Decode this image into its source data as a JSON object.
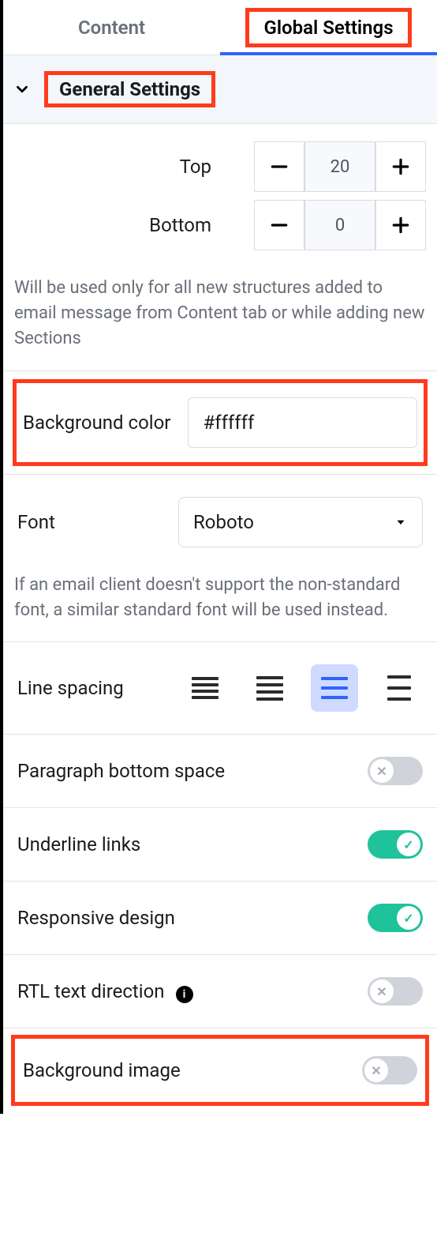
{
  "tabs": {
    "content": "Content",
    "global": "Global Settings",
    "active": "global"
  },
  "accordion": {
    "title": "General Settings"
  },
  "padding": {
    "top_label": "Top",
    "top_value": "20",
    "bottom_label": "Bottom",
    "bottom_value": "0",
    "helper": "Will be used only for all new structures added to email message from Content tab or while adding new Sections"
  },
  "bg_color": {
    "label": "Background color",
    "value": "#ffffff"
  },
  "font": {
    "label": "Font",
    "value": "Roboto",
    "helper": "If an email client doesn't support the non-standard font, a similar standard font will be used instead."
  },
  "line_spacing": {
    "label": "Line spacing",
    "selected_index": 2
  },
  "toggles": {
    "paragraph_bottom": {
      "label": "Paragraph bottom space",
      "on": false
    },
    "underline_links": {
      "label": "Underline links",
      "on": true
    },
    "responsive": {
      "label": "Responsive design",
      "on": true
    },
    "rtl": {
      "label": "RTL text direction",
      "on": false
    },
    "bg_image": {
      "label": "Background image",
      "on": false
    }
  }
}
